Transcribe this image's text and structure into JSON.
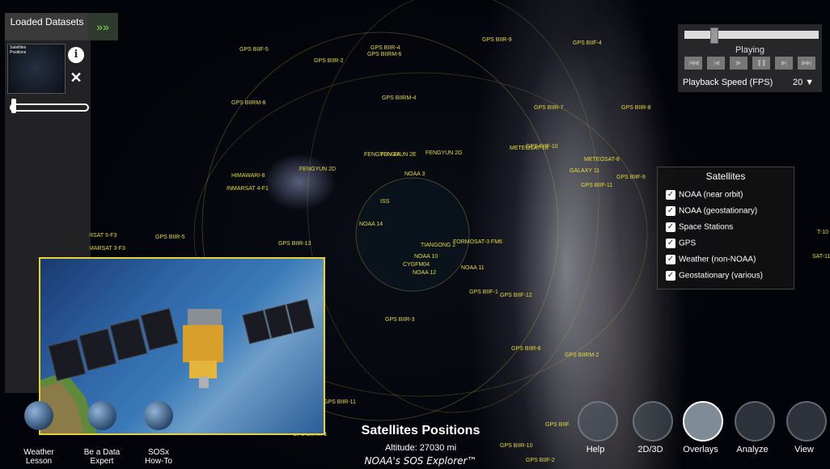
{
  "loaded_datasets": {
    "title": "Loaded Datasets",
    "expand_icon": "chevron-double-right-icon",
    "thumbnail_label": "Satellites Positions",
    "info_icon": "info-icon",
    "close_icon": "close-icon"
  },
  "playback": {
    "status": "Playing",
    "speed_label": "Playback Speed (FPS)",
    "speed_value": "20 ▼",
    "buttons": [
      "skip-back",
      "step-back",
      "play",
      "pause",
      "step-forward",
      "skip-forward"
    ]
  },
  "satellites_panel": {
    "title": "Satellites",
    "items": [
      {
        "label": "NOAA (near orbit)",
        "checked": true
      },
      {
        "label": "NOAA (geostationary)",
        "checked": true
      },
      {
        "label": "Space Stations",
        "checked": true
      },
      {
        "label": "GPS",
        "checked": true
      },
      {
        "label": "Weather (non-NOAA)",
        "checked": true
      },
      {
        "label": "Geostationary (various)",
        "checked": true
      }
    ]
  },
  "satellite_labels": [
    "GPS BIIF-5",
    "GPS BIIR-4",
    "GPS BIIRM-6",
    "GPS BIIR-2",
    "GPS BIIR-9",
    "GPS BIIF-4",
    "GPS BIIRM-8",
    "GPS BIIRM-4",
    "GPS BIIR-7",
    "GPS BIIR-8",
    "FENGYUN 2D",
    "FENGYUN 4A",
    "FENGYUN 2E",
    "FENGYUN 2G",
    "HIMAWARI-8",
    "INMARSAT 4-F1",
    "METEOSAT-8",
    "GALAXY 11",
    "GPS BIIF-9",
    "GPS BIIF-11",
    "GPS BIIF-10",
    "NOAA 3",
    "NOAA 14",
    "ISS",
    "FORMOSAT-3 FM6",
    "TIANGONG 2",
    "NOAA 10",
    "NOAA 11",
    "NOAA 12",
    "CYGFM04",
    "GPS BIIR-13",
    "GPS BIIR-5",
    "RSAT 5-F3",
    "MARSAT 3-F3",
    "GPS BIIF-1",
    "GPS BIIF-12",
    "METEOSAT-10",
    "GPS BIIR-3",
    "GPS BIIR-6",
    "GPS BIIRM-2",
    "GPS BIIR-11",
    "GPS BIIRM-1",
    "GPS BIIR-10",
    "GPS BIIF-2",
    "GPS BIIF",
    "T-10",
    "SAT-11"
  ],
  "bottom_left": [
    {
      "label": "Weather\nLesson",
      "icon": "globe-icon"
    },
    {
      "label": "Be a Data\nExpert",
      "icon": "globe-icon"
    },
    {
      "label": "SOSx\nHow-To",
      "icon": "globe-icon"
    }
  ],
  "dataset": {
    "title": "Satellites Positions",
    "altitude": "Altitude: 27030 mi",
    "brand": "NOAA's SOS Explorer™"
  },
  "toolbar": [
    {
      "label": "Help",
      "icon": "hand-touch-icon",
      "active": false
    },
    {
      "label": "2D/3D",
      "icon": "map-icon",
      "active": false
    },
    {
      "label": "Overlays",
      "icon": "globe-overlay-icon",
      "active": true
    },
    {
      "label": "Analyze",
      "icon": "eyedropper-icon",
      "active": false
    },
    {
      "label": "View",
      "icon": "move-arrows-icon",
      "active": false
    }
  ]
}
